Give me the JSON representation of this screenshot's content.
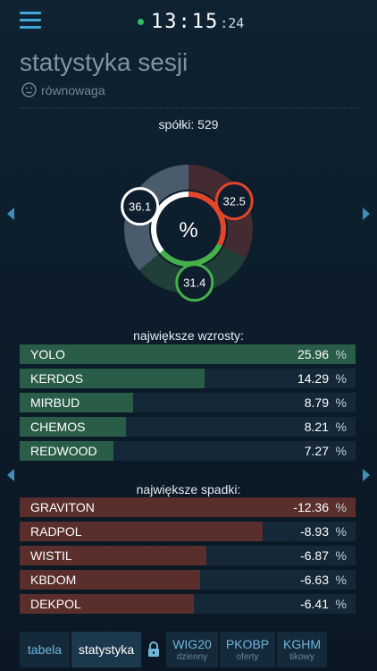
{
  "header": {
    "time_hm": "13:15",
    "time_sec": ":24"
  },
  "page": {
    "title": "statystyka sesji",
    "sentiment": "równowaga",
    "companies_label": "spółki: 529"
  },
  "chart_data": {
    "type": "pie",
    "center_label": "%",
    "slices": [
      {
        "name": "down",
        "value": 32.5,
        "color": "#e3452a"
      },
      {
        "name": "up",
        "value": 31.4,
        "color": "#46b04a"
      },
      {
        "name": "unchanged",
        "value": 36.1,
        "color": "#ffffff"
      }
    ]
  },
  "gainers": {
    "title": "największe wzrosty:",
    "items": [
      {
        "name": "YOLO",
        "value": "25.96",
        "pct": "%",
        "num": 25.96
      },
      {
        "name": "KERDOS",
        "value": "14.29",
        "pct": "%",
        "num": 14.29
      },
      {
        "name": "MIRBUD",
        "value": "8.79",
        "pct": "%",
        "num": 8.79
      },
      {
        "name": "CHEMOS",
        "value": "8.21",
        "pct": "%",
        "num": 8.21
      },
      {
        "name": "REDWOOD",
        "value": "7.27",
        "pct": "%",
        "num": 7.27
      }
    ]
  },
  "losers": {
    "title": "największe spadki:",
    "items": [
      {
        "name": "GRAVITON",
        "value": "-12.36",
        "pct": "%",
        "num": 12.36
      },
      {
        "name": "RADPOL",
        "value": "-8.93",
        "pct": "%",
        "num": 8.93
      },
      {
        "name": "WISTIL",
        "value": "-6.87",
        "pct": "%",
        "num": 6.87
      },
      {
        "name": "KBDOM",
        "value": "-6.63",
        "pct": "%",
        "num": 6.63
      },
      {
        "name": "DEKPOL",
        "value": "-6.41",
        "pct": "%",
        "num": 6.41
      }
    ]
  },
  "tabs": [
    {
      "label": "tabela",
      "sub": ""
    },
    {
      "label": "statystyka",
      "sub": ""
    },
    {
      "label": "WIG20",
      "sub": "dzienny"
    },
    {
      "label": "PKOBP",
      "sub": "oferty"
    },
    {
      "label": "KGHM",
      "sub": "tikowy"
    }
  ],
  "colors": {
    "accent": "#3fa9d6",
    "up": "#2a5d48",
    "down": "#5a2e2a"
  }
}
